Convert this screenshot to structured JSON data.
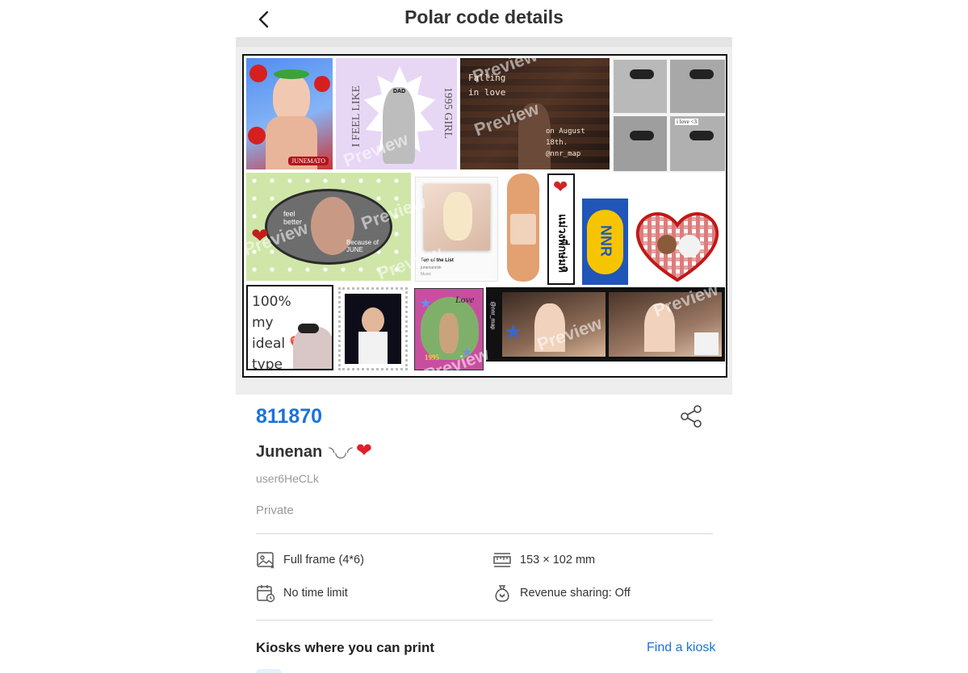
{
  "header": {
    "title": "Polar code details"
  },
  "preview": {
    "watermark": "Preview",
    "tiles": {
      "junemato": "JUNEMATO",
      "feel_like_left": "I FEEL LIKE",
      "feel_like_right": "1995 GIRL",
      "cap": "DAD",
      "falling": "Falling in love",
      "august": "on August 18th. @nnr_map",
      "ilove": "i love <3",
      "feel_better": "feel better",
      "because": "Because of JUNE",
      "card_title": "Top of the List",
      "card_sub": "junenanniin",
      "card_music": "Music",
      "thai": "แม่วงพี่กษ่มหิ",
      "nnr": "NNR",
      "ideal": "100% my ideal ❤️ type",
      "love": "Love",
      "year": "1995",
      "nnr_map": "@nnr_map"
    }
  },
  "info": {
    "code": "811870",
    "author_name": "Junenan",
    "author_emoji": "◝◡◜",
    "author_heart": "❤",
    "username": "user6HeCLk",
    "privacy": "Private"
  },
  "specs": [
    {
      "icon": "image-icon",
      "label": "Full frame (4*6)"
    },
    {
      "icon": "ruler-icon",
      "label": "153 × 102 mm"
    },
    {
      "icon": "calendar-clock-icon",
      "label": "No time limit"
    },
    {
      "icon": "money-bag-icon",
      "label": "Revenue sharing: Off"
    }
  ],
  "kiosks": {
    "title": "Kiosks where you can print",
    "link": "Find a kiosk"
  },
  "colors": {
    "accent": "#1a73d9",
    "heart": "#e0202a",
    "divider": "#d8d8d8"
  }
}
